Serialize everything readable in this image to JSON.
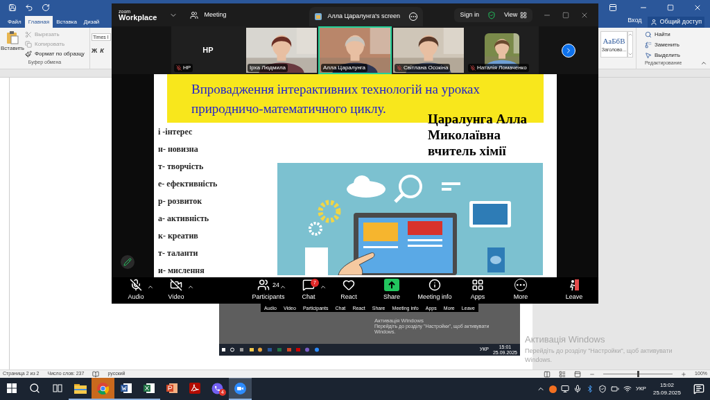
{
  "word": {
    "account": {
      "sign_in": "Вход",
      "share": "Общий доступ"
    },
    "tabs": [
      {
        "label": "Файл",
        "selected": false
      },
      {
        "label": "Главная",
        "selected": true
      },
      {
        "label": "Вставка",
        "selected": false
      },
      {
        "label": "Дизай",
        "selected": false
      }
    ],
    "clipboard": {
      "paste": "Вставить",
      "group": "Буфер обмена",
      "commands": [
        {
          "kind": "cut",
          "label": "Вырезать",
          "disabled": true
        },
        {
          "kind": "copy",
          "label": "Копировать",
          "disabled": true
        },
        {
          "kind": "painter",
          "label": "Формат по образцу",
          "disabled": false
        }
      ]
    },
    "font": {
      "name": "Times I",
      "bold": "Ж",
      "italic": "К"
    },
    "styles": {
      "sample": "АаБбВ",
      "name": "Заголово..."
    },
    "editing": {
      "group": "Редактирование",
      "commands": [
        {
          "kind": "find",
          "label": "Найти"
        },
        {
          "kind": "replace",
          "label": "Заменить"
        },
        {
          "kind": "select",
          "label": "Выделить"
        }
      ]
    },
    "status_bar": {
      "page": "Страница 2 из 2",
      "words": "Число слов: 237",
      "language": "русский",
      "zoom": "100%",
      "level": 0.5
    }
  },
  "inner_screen": {
    "toolbar": [
      "Audio",
      "Video",
      "Participants",
      "Chat",
      "React",
      "Share",
      "Meeting info",
      "Apps",
      "More",
      "Leave"
    ],
    "activation_title": "Активація Windows",
    "activation_text": "Перейдіть до розділу \"Настройки\", щоб активувати Windows.",
    "language": "УКР",
    "time": "15:01",
    "date": "25.09.2025"
  },
  "zoom": {
    "brand_small": "zoom",
    "brand": "Workplace",
    "meeting": "Meeting",
    "share_tab": "Алла Царалунга's screen",
    "sign_in": "Sign in",
    "view": "View",
    "gallery": [
      {
        "kind": "avatar",
        "initials": "HP",
        "name": "HP",
        "muted": true,
        "selected": false
      },
      {
        "kind": "video",
        "name": "Ірха Людмила",
        "muted": false,
        "selected": false
      },
      {
        "kind": "video",
        "name": "Алла Царалунга",
        "muted": false,
        "selected": true
      },
      {
        "kind": "video",
        "name": "Світлана Осокіна",
        "muted": true,
        "selected": false
      },
      {
        "name": "Наталія Ломаченко",
        "muted": true,
        "selected": false
      }
    ],
    "slide": {
      "title_lines": [
        "Впровадження інтерактивних технологій на уроках",
        "природничо-математичного циклу."
      ],
      "author": [
        "Царалунга Алла",
        "Миколаївна",
        "вчитель хімії"
      ],
      "list": [
        "і -інтерес",
        "н- новизна",
        "т- творчість",
        "е- ефективність",
        "р- розвиток",
        "а- активність",
        "к- креатив",
        "т- таланти",
        "и- мислення"
      ]
    },
    "toolbar": [
      {
        "kind": "audio",
        "label": "Audio",
        "off": true,
        "caret": true
      },
      {
        "kind": "video",
        "label": "Video",
        "off": true,
        "caret": true
      },
      {
        "kind": "participants",
        "label": "Participants",
        "count": "24",
        "caret": true
      },
      {
        "kind": "chat",
        "label": "Chat",
        "badge": "7",
        "caret": true
      },
      {
        "kind": "react",
        "label": "React"
      },
      {
        "kind": "share",
        "label": "Share"
      },
      {
        "kind": "info",
        "label": "Meeting info"
      },
      {
        "kind": "apps",
        "label": "Apps"
      },
      {
        "kind": "more",
        "label": "More"
      },
      {
        "kind": "leave",
        "label": "Leave"
      }
    ]
  },
  "activation": {
    "title": "Активація Windows",
    "text": "Перейдіть до розділу \"Настройки\", щоб активувати Windows."
  },
  "taskbar": {
    "apps": [
      {
        "kind": "start",
        "open": false,
        "flashing": false,
        "selected": false
      },
      {
        "kind": "search",
        "open": false,
        "flashing": false,
        "selected": false
      },
      {
        "kind": "taskview",
        "open": false,
        "flashing": false,
        "selected": false
      },
      {
        "kind": "explorer",
        "open": true,
        "flashing": false,
        "selected": false
      },
      {
        "kind": "chrome",
        "open": true,
        "flashing": true,
        "selected": false
      },
      {
        "kind": "word",
        "open": true,
        "flashing": false,
        "selected": false
      },
      {
        "kind": "excel",
        "open": true,
        "flashing": false,
        "selected": false
      },
      {
        "kind": "powerpoint",
        "open": false,
        "flashing": false,
        "selected": false
      },
      {
        "kind": "acrobat",
        "open": false,
        "flashing": false,
        "selected": false
      },
      {
        "kind": "viber",
        "open": false,
        "flashing": false,
        "selected": false,
        "badge": "4"
      },
      {
        "kind": "zoom",
        "open": true,
        "flashing": false,
        "selected": true
      }
    ],
    "language": "УКР",
    "time": "15:02",
    "date": "25.09.2025"
  }
}
